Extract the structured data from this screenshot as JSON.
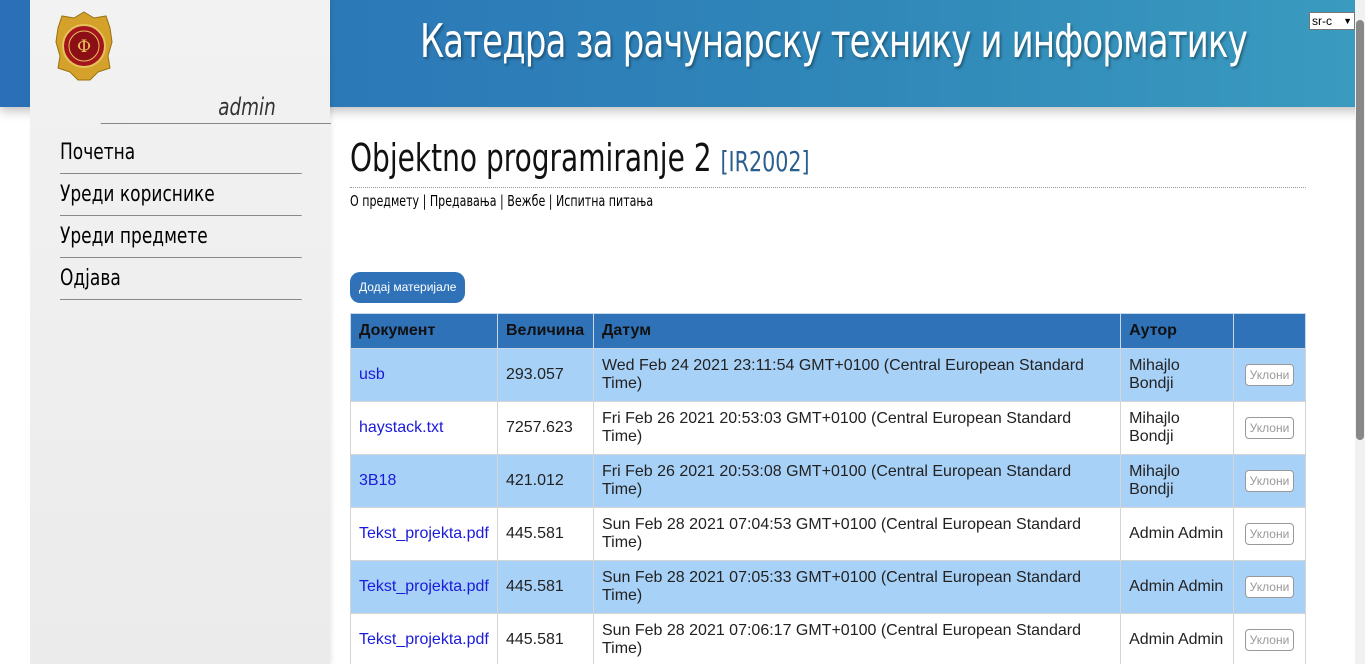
{
  "header": {
    "title": "Катедра за рачунарску технику и информатику",
    "language": "sr-c"
  },
  "sidebar": {
    "user": "admin",
    "items": [
      {
        "label": "Почетна"
      },
      {
        "label": "Уреди кориснике"
      },
      {
        "label": "Уреди предмете"
      },
      {
        "label": "Одјава"
      }
    ]
  },
  "course": {
    "title": "Objektno programiranje 2",
    "code": "[IR2002]",
    "subnav": [
      {
        "label": "О предмету"
      },
      {
        "label": "Предавања"
      },
      {
        "label": "Вежбе"
      },
      {
        "label": "Испитна питања"
      }
    ],
    "separator": " | ",
    "add_button": "Додај материјале"
  },
  "table": {
    "headers": [
      "Документ",
      "Величина",
      "Датум",
      "Аутор",
      ""
    ],
    "remove_label": "Уклони",
    "rows": [
      {
        "doc": "usb",
        "size": "293.057",
        "date": "Wed Feb 24 2021 23:11:54 GMT+0100 (Central European Standard Time)",
        "author": "Mihajlo Bondji"
      },
      {
        "doc": "haystack.txt",
        "size": "7257.623",
        "date": "Fri Feb 26 2021 20:53:03 GMT+0100 (Central European Standard Time)",
        "author": "Mihajlo Bondji"
      },
      {
        "doc": "3B18",
        "size": "421.012",
        "date": "Fri Feb 26 2021 20:53:08 GMT+0100 (Central European Standard Time)",
        "author": "Mihajlo Bondji"
      },
      {
        "doc": "Tekst_projekta.pdf",
        "size": "445.581",
        "date": "Sun Feb 28 2021 07:04:53 GMT+0100 (Central European Standard Time)",
        "author": "Admin Admin"
      },
      {
        "doc": "Tekst_projekta.pdf",
        "size": "445.581",
        "date": "Sun Feb 28 2021 07:05:33 GMT+0100 (Central European Standard Time)",
        "author": "Admin Admin"
      },
      {
        "doc": "Tekst_projekta.pdf",
        "size": "445.581",
        "date": "Sun Feb 28 2021 07:06:17 GMT+0100 (Central European Standard Time)",
        "author": "Admin Admin"
      }
    ]
  },
  "colors": {
    "header_start": "#2a6fb7",
    "header_end": "#3a9bbf",
    "table_header": "#2f72b8",
    "row_highlight": "#a8d1f7",
    "link": "#1a1adb"
  }
}
